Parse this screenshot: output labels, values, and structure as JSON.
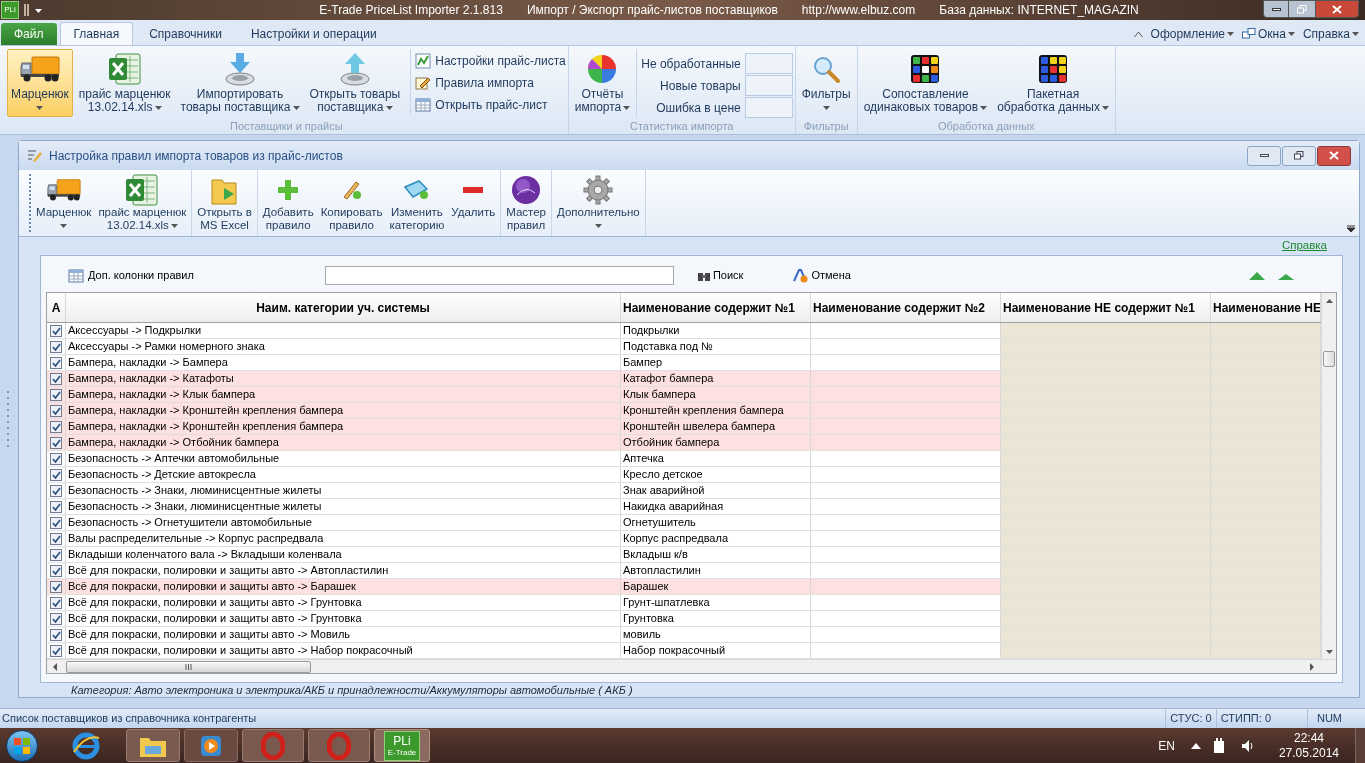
{
  "window": {
    "logo": "PLi",
    "title_parts": [
      "E-Trade PriceList Importer 2.1.813",
      "Импорт / Экспорт прайс-листов поставщиков",
      "http://www.elbuz.com",
      "База данных: INTERNET_MAGAZIN"
    ]
  },
  "menu_tabs": [
    {
      "label": "Файл",
      "kind": "file",
      "selected": false
    },
    {
      "label": "Главная",
      "kind": "tab",
      "selected": true
    },
    {
      "label": "Справочники",
      "kind": "tab",
      "selected": false
    },
    {
      "label": "Настройки и операции",
      "kind": "tab",
      "selected": false
    }
  ],
  "menu_right": [
    "Оформление",
    "Окна",
    "Справка"
  ],
  "ribbon": [
    {
      "title": "Поставщики и прайсы",
      "items": [
        {
          "kind": "large",
          "lines": [
            "Марценюк"
          ],
          "dropdown": true,
          "selected": true
        },
        {
          "kind": "large",
          "lines": [
            "прайс марценюк",
            "13.02.14.xls"
          ],
          "dropdown": true,
          "selected": false
        },
        {
          "kind": "large",
          "lines": [
            "Импортировать",
            "товары поставщика"
          ],
          "dropdown": true,
          "selected": false
        },
        {
          "kind": "large",
          "lines": [
            "Открыть товары",
            "поставщика"
          ],
          "dropdown": true,
          "selected": false
        },
        {
          "kind": "stack",
          "entries": [
            "Настройки прайс-листа",
            "Правила импорта",
            "Открыть прайс-лист"
          ]
        }
      ]
    },
    {
      "title": "Статистика импорта",
      "items": [
        {
          "kind": "large",
          "lines": [
            "Отчёты",
            "импорта"
          ],
          "dropdown": true,
          "selected": false
        },
        {
          "kind": "counters",
          "entries": [
            "Не обработанные",
            "Новые товары",
            "Ошибка в цене"
          ]
        }
      ]
    },
    {
      "title": "Фильтры",
      "items": [
        {
          "kind": "large",
          "lines": [
            "Фильтры"
          ],
          "dropdown": true,
          "selected": false
        }
      ]
    },
    {
      "title": "Обработка данных",
      "items": [
        {
          "kind": "large",
          "lines": [
            "Сопоставление",
            "одинаковых товаров"
          ],
          "dropdown": true,
          "selected": false
        },
        {
          "kind": "large",
          "lines": [
            "Пакетная",
            "обработка данных"
          ],
          "dropdown": true,
          "selected": false
        }
      ]
    }
  ],
  "child_window": {
    "title": "Настройка правил импорта товаров из прайс-листов",
    "toolbar": [
      [
        {
          "lines": [
            "Марценюк"
          ],
          "dropdown": true
        },
        {
          "lines": [
            "прайс марценюк",
            "13.02.14.xls"
          ],
          "dropdown": true
        }
      ],
      [
        {
          "lines": [
            "Открыть в",
            "MS Excel"
          ],
          "dropdown": false
        }
      ],
      [
        {
          "lines": [
            "Добавить",
            "правило"
          ],
          "dropdown": false
        },
        {
          "lines": [
            "Копировать",
            "правило"
          ],
          "dropdown": false
        },
        {
          "lines": [
            "Изменить",
            "категорию"
          ],
          "dropdown": false
        },
        {
          "lines": [
            "Удалить"
          ],
          "dropdown": false
        }
      ],
      [
        {
          "lines": [
            "Мастер",
            "правил"
          ],
          "dropdown": false
        }
      ],
      [
        {
          "lines": [
            "Дополнительно"
          ],
          "dropdown": true
        }
      ]
    ],
    "help_link": "Справка",
    "search": {
      "columns_button": "Доп. колонки правил",
      "find_button": "Поиск",
      "cancel_button": "Отмена"
    },
    "table": {
      "columns": [
        "A",
        "Наим. категории уч. системы",
        "Наименование содержит №1",
        "Наименование содержит №2",
        "Наименование НЕ содержит №1",
        "Наименование НЕ"
      ],
      "rows": [
        {
          "checked": true,
          "highlighted": false,
          "category": "Аксессуары -> Подкрылки",
          "contains_1": "Подкрылки"
        },
        {
          "checked": true,
          "highlighted": false,
          "category": "Аксессуары -> Рамки номерного знака",
          "contains_1": "Подставка под №"
        },
        {
          "checked": true,
          "highlighted": false,
          "category": "Бампера, накладки -> Бампера",
          "contains_1": "Бампер"
        },
        {
          "checked": true,
          "highlighted": true,
          "category": "Бампера, накладки -> Катафоты",
          "contains_1": "Катафот бампера"
        },
        {
          "checked": true,
          "highlighted": true,
          "category": "Бампера, накладки -> Клык бампера",
          "contains_1": "Клык бампера"
        },
        {
          "checked": true,
          "highlighted": true,
          "category": "Бампера, накладки -> Кронштейн крепления бампера",
          "contains_1": "Кронштейн крепления бампера"
        },
        {
          "checked": true,
          "highlighted": true,
          "category": "Бампера, накладки -> Кронштейн крепления бампера",
          "contains_1": "Кронштейн швелера бампера"
        },
        {
          "checked": true,
          "highlighted": true,
          "category": "Бампера, накладки -> Отбойник бампера",
          "contains_1": "Отбойник бампера"
        },
        {
          "checked": true,
          "highlighted": false,
          "category": "Безопасность -> Аптечки автомобильные",
          "contains_1": "Аптечка"
        },
        {
          "checked": true,
          "highlighted": false,
          "category": "Безопасность -> Детские автокресла",
          "contains_1": "Кресло детское"
        },
        {
          "checked": true,
          "highlighted": false,
          "category": "Безопасность -> Знаки, люминисцентные жилеты",
          "contains_1": "Знак аварийной"
        },
        {
          "checked": true,
          "highlighted": false,
          "category": "Безопасность -> Знаки, люминисцентные жилеты",
          "contains_1": "Накидка аварийная"
        },
        {
          "checked": true,
          "highlighted": false,
          "category": "Безопасность -> Огнетушители автомобильные",
          "contains_1": "Огнетушитель"
        },
        {
          "checked": true,
          "highlighted": false,
          "category": "Валы распределительные -> Корпус распредвала",
          "contains_1": "Корпус распредвала"
        },
        {
          "checked": true,
          "highlighted": false,
          "category": "Вкладыши коленчатого вала -> Вкладыши коленвала",
          "contains_1": "Вкладыш к/в"
        },
        {
          "checked": true,
          "highlighted": false,
          "category": "Всё для покраски, полировки и защиты авто -> Автопластилин",
          "contains_1": "Автопластилин"
        },
        {
          "checked": true,
          "highlighted": true,
          "category": "Всё для покраски, полировки и защиты авто -> Барашек",
          "contains_1": "Барашек"
        },
        {
          "checked": true,
          "highlighted": false,
          "category": "Всё для покраски, полировки и защиты авто -> Грунтовка",
          "contains_1": "Грунт-шпатлевка"
        },
        {
          "checked": true,
          "highlighted": false,
          "category": "Всё для покраски, полировки и защиты авто -> Грунтовка",
          "contains_1": "Грунтовка"
        },
        {
          "checked": true,
          "highlighted": false,
          "category": "Всё для покраски, полировки и защиты авто -> Мовиль",
          "contains_1": "мовиль"
        },
        {
          "checked": true,
          "highlighted": false,
          "category": "Всё для покраски, полировки и защиты авто -> Набор покрасочный",
          "contains_1": "Набор покрасочный"
        }
      ]
    },
    "category_path": "Категория: Авто электроника и электрика/АКБ и принадлежности/Аккумуляторы автомобильные ( АКБ )"
  },
  "status_bar": {
    "message": "Список поставщиков из справочника контрагенты",
    "panels": [
      "СТУС: 0",
      "СТИПП: 0",
      "NUM"
    ]
  },
  "taskbar": {
    "active_app_logo": "PLi",
    "active_app_caption": "E-Trade",
    "language": "EN",
    "time": "22:44",
    "date": "27.05.2014"
  }
}
